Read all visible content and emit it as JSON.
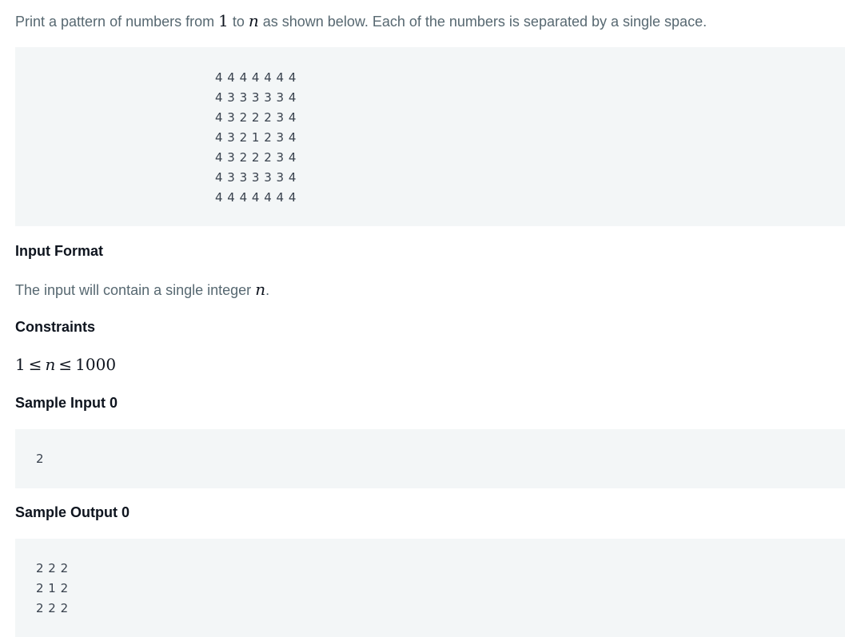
{
  "intro": {
    "before": "Print a pattern of numbers from ",
    "num_one": "1",
    "mid": " to ",
    "var_n": "n",
    "after": " as shown below. Each of the numbers is separated by a single space."
  },
  "pattern_example": "4 4 4 4 4 4 4\n4 3 3 3 3 3 4\n4 3 2 2 2 3 4\n4 3 2 1 2 3 4\n4 3 2 2 2 3 4\n4 3 3 3 3 3 4\n4 4 4 4 4 4 4",
  "input_format": {
    "heading": "Input Format",
    "text_before": "The input will contain a single integer ",
    "var_n": "n",
    "text_after": "."
  },
  "constraints": {
    "heading": "Constraints",
    "lower": "1",
    "op1": "≤",
    "var_n": "n",
    "op2": "≤",
    "upper": "1000"
  },
  "sample_input": {
    "heading": "Sample Input 0",
    "value": "2"
  },
  "sample_output": {
    "heading": "Sample Output 0",
    "value": "2 2 2\n2 1 2\n2 2 2"
  }
}
